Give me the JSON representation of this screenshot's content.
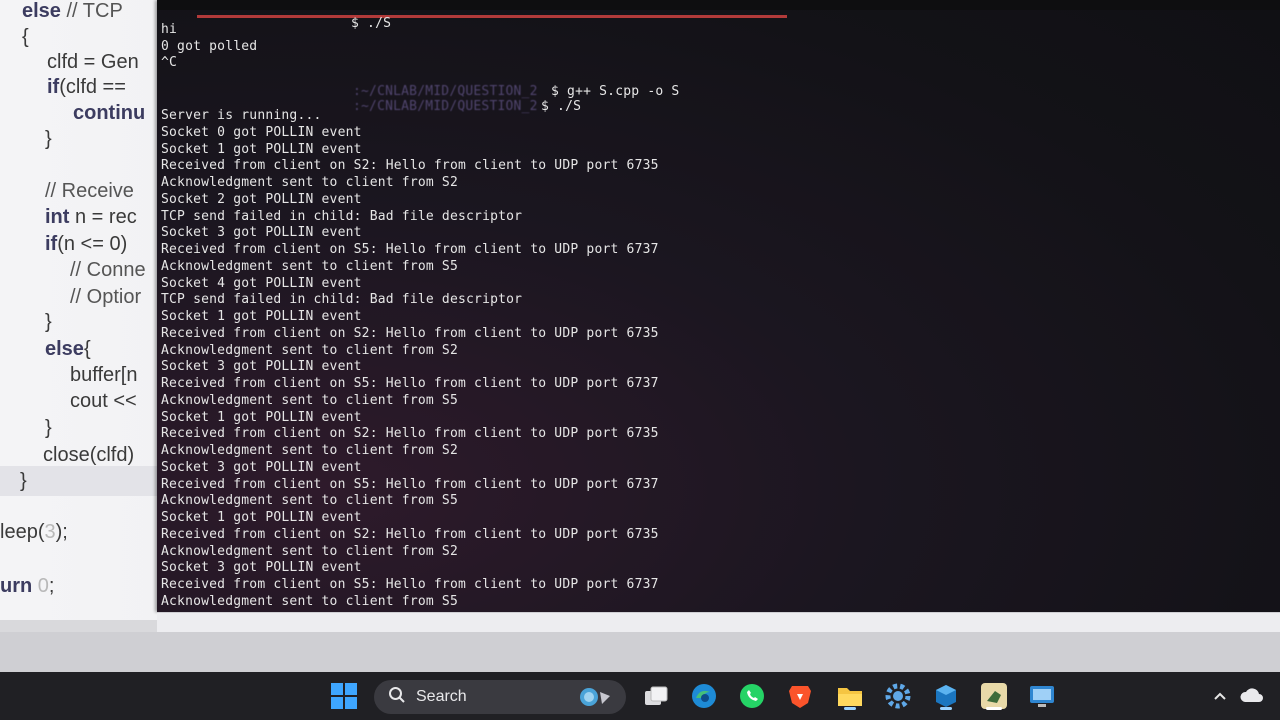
{
  "editor": {
    "lines": [
      {
        "parts": [
          {
            "c": "c-kw",
            "t": "else"
          },
          {
            "c": "c-cm",
            "t": " // TCP"
          }
        ]
      },
      {
        "parts": [
          {
            "c": "c-tx",
            "t": "{"
          }
        ]
      },
      {
        "parts": [
          {
            "c": "c-tx",
            "t": "clfd = Gen"
          }
        ]
      },
      {
        "parts": [
          {
            "c": "c-kw",
            "t": "if"
          },
          {
            "c": "c-tx",
            "t": "(clfd =="
          }
        ]
      },
      {
        "parts": [
          {
            "c": "c-kw",
            "t": "continu"
          }
        ]
      },
      {
        "parts": [
          {
            "c": "c-tx",
            "t": "}"
          }
        ]
      },
      {
        "parts": [
          {
            "c": "c-cm",
            "t": "// Receive"
          }
        ]
      },
      {
        "parts": [
          {
            "c": "c-kw",
            "t": "int"
          },
          {
            "c": "c-tx",
            "t": " n = rec"
          }
        ]
      },
      {
        "parts": [
          {
            "c": "c-kw",
            "t": "if"
          },
          {
            "c": "c-tx",
            "t": "(n <= 0)"
          }
        ]
      },
      {
        "parts": [
          {
            "c": "c-cm",
            "t": "// Conne"
          }
        ]
      },
      {
        "parts": [
          {
            "c": "c-cm",
            "t": "// Optior"
          }
        ]
      },
      {
        "parts": [
          {
            "c": "c-tx",
            "t": "}"
          }
        ]
      },
      {
        "parts": [
          {
            "c": "c-kw",
            "t": "else"
          },
          {
            "c": "c-tx",
            "t": "{"
          }
        ]
      },
      {
        "parts": [
          {
            "c": "c-tx",
            "t": "buffer[n"
          }
        ]
      },
      {
        "parts": [
          {
            "c": "c-tx",
            "t": "cout <<"
          }
        ]
      },
      {
        "parts": [
          {
            "c": "c-tx",
            "t": "}"
          }
        ]
      },
      {
        "parts": [
          {
            "c": "c-tx",
            "t": "close(clfd)"
          }
        ]
      },
      {
        "parts": [
          {
            "c": "c-tx",
            "t": "}"
          }
        ]
      },
      {
        "parts": [
          {
            "c": "c-tx",
            "t": "leep("
          },
          {
            "c": "c-num",
            "t": "3"
          },
          {
            "c": "c-tx",
            "t": ");"
          }
        ]
      },
      {
        "parts": [
          {
            "c": "c-kw",
            "t": "urn"
          },
          {
            "c": "c-num",
            "t": " 0"
          },
          {
            "c": "c-tx",
            "t": ";"
          }
        ]
      }
    ]
  },
  "terminal": {
    "prompt_cmd_1": "$ ./S",
    "hi": "hi",
    "got_polled": "0 got polled",
    "ctrl_c": "^C",
    "prompt_path_1": ":~/CNLAB/MID/QUESTION_2",
    "prompt_cmd_2": "$ g++ S.cpp -o S",
    "prompt_path_2": ":~/CNLAB/MID/QUESTION_2",
    "prompt_cmd_3": "$ ./S",
    "output": [
      "Server is running...",
      "Socket 0 got POLLIN event",
      "Socket 1 got POLLIN event",
      "Received from client on S2: Hello from client to UDP port 6735",
      "Acknowledgment sent to client from S2",
      "Socket 2 got POLLIN event",
      "TCP send failed in child: Bad file descriptor",
      "Socket 3 got POLLIN event",
      "Received from client on S5: Hello from client to UDP port 6737",
      "Acknowledgment sent to client from S5",
      "Socket 4 got POLLIN event",
      "TCP send failed in child: Bad file descriptor",
      "Socket 1 got POLLIN event",
      "Received from client on S2: Hello from client to UDP port 6735",
      "Acknowledgment sent to client from S2",
      "Socket 3 got POLLIN event",
      "Received from client on S5: Hello from client to UDP port 6737",
      "Acknowledgment sent to client from S5",
      "Socket 1 got POLLIN event",
      "Received from client on S2: Hello from client to UDP port 6735",
      "Acknowledgment sent to client from S2",
      "Socket 3 got POLLIN event",
      "Received from client on S5: Hello from client to UDP port 6737",
      "Acknowledgment sent to client from S5",
      "Socket 1 got POLLIN event",
      "Received from client on S2: Hello from client to UDP port 6735",
      "Acknowledgment sent to client from S2",
      "Socket 3 got POLLIN event",
      "Received from client on S5: Hello from client to UDP port 6737",
      "Acknowledgment sent to client from S5"
    ]
  },
  "taskbar": {
    "search_label": "Search",
    "icons": [
      "windows-start-icon",
      "search-icon",
      "widgets-icon",
      "task-view-icon",
      "edge-icon",
      "whatsapp-icon",
      "brave-icon",
      "file-explorer-icon",
      "settings-icon",
      "virtualbox-icon",
      "vscode-icon",
      "remote-desktop-icon",
      "tray-chevron-icon",
      "onedrive-icon"
    ]
  },
  "colors": {
    "terminal_bg": "#131217",
    "terminal_text": "#e6e6e6",
    "accent_red": "#b23a3a",
    "taskbar_bg": "#202024"
  }
}
